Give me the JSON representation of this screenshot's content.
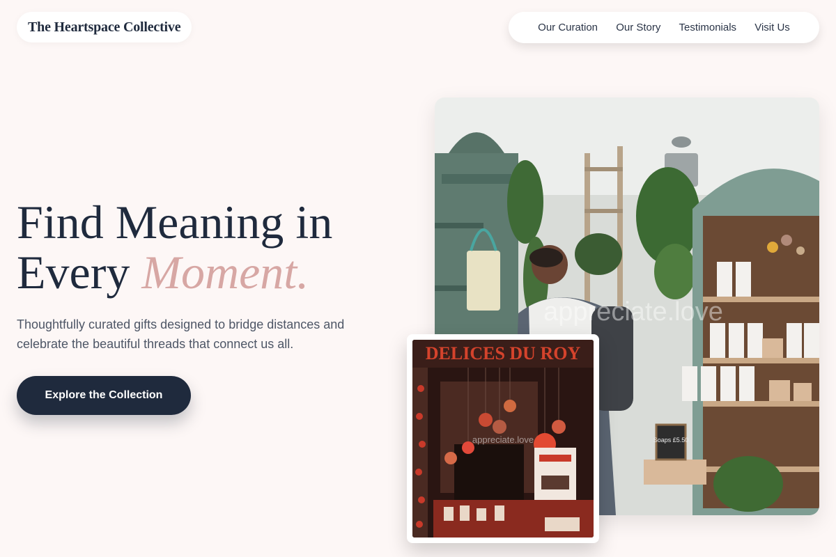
{
  "brand": {
    "name": "The Heartspace Collective"
  },
  "nav": {
    "items": [
      "Our Curation",
      "Our Story",
      "Testimonials",
      "Visit Us"
    ]
  },
  "hero": {
    "title_line1": "Find Meaning in",
    "title_line2_plain": "Every ",
    "title_line2_accent": "Moment.",
    "subtitle": "Thoughtfully curated gifts designed to bridge distances and celebrate the beautiful threads that connect us all.",
    "cta_label": "Explore the Collection"
  },
  "images": {
    "main_watermark": "appreciate.love",
    "small_watermark": "appreciate.love",
    "small_sign": "DELICES DU ROY",
    "chalk_sign": "Soaps £5.50"
  },
  "colors": {
    "primary": "#1f2a3d",
    "accent": "#d7a7a4",
    "background": "#fdf7f6"
  }
}
